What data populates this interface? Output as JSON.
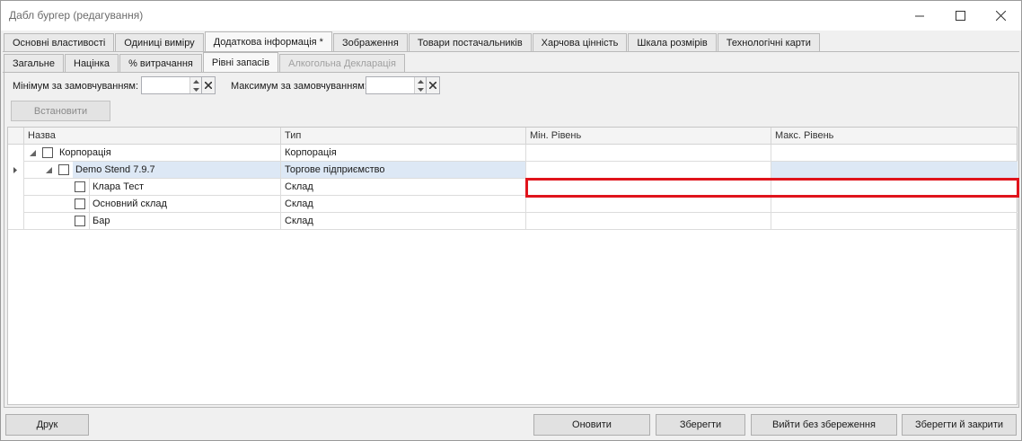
{
  "window": {
    "title": "Дабл бургер (редагування)",
    "controls": [
      "minimize-icon",
      "maximize-icon",
      "close-icon"
    ]
  },
  "main_tabs": [
    {
      "label": "Основні властивості",
      "active": false
    },
    {
      "label": "Одиниці виміру",
      "active": false
    },
    {
      "label": "Додаткова інформація *",
      "active": true
    },
    {
      "label": "Зображення",
      "active": false
    },
    {
      "label": "Товари постачальників",
      "active": false
    },
    {
      "label": "Харчова цінність",
      "active": false
    },
    {
      "label": "Шкала розмірів",
      "active": false
    },
    {
      "label": "Технологічні карти",
      "active": false
    }
  ],
  "sub_tabs": [
    {
      "label": "Загальне",
      "active": false,
      "disabled": false
    },
    {
      "label": "Націнка",
      "active": false,
      "disabled": false
    },
    {
      "label": "% витрачання",
      "active": false,
      "disabled": false
    },
    {
      "label": "Рівні запасів",
      "active": true,
      "disabled": false
    },
    {
      "label": "Алкогольна Декларація",
      "active": false,
      "disabled": true
    }
  ],
  "filters": {
    "min_label": "Мінімум за замовчуванням:",
    "min_value": "",
    "max_label": "Максимум за замовчуванням:",
    "max_value": "",
    "set_button": "Встановити"
  },
  "grid": {
    "columns": [
      "Назва",
      "Тип",
      "Мін. Рівень",
      "Макс. Рівень"
    ],
    "rows": [
      {
        "name": "Корпорація",
        "type": "Корпорація",
        "min": "",
        "max": "",
        "level": 0,
        "expanded": true
      },
      {
        "name": "Demo Stend 7.9.7",
        "type": "Торгове підприємство",
        "min": "",
        "max": "",
        "level": 1,
        "expanded": true,
        "selected": true
      },
      {
        "name": "Клара Тест",
        "type": "Склад",
        "min": "",
        "max": "",
        "level": 2
      },
      {
        "name": "Основний склад",
        "type": "Склад",
        "min": "",
        "max": "",
        "level": 2
      },
      {
        "name": "Бар",
        "type": "Склад",
        "min": "",
        "max": "",
        "level": 2
      }
    ]
  },
  "buttons": {
    "print": "Друк",
    "refresh": "Оновити",
    "save": "Зберегти",
    "exit_no_save": "Вийти без збереження",
    "save_close": "Зберегти й закрити"
  },
  "colors": {
    "selected_row": "#dde8f5",
    "highlight": "#e0141c"
  }
}
